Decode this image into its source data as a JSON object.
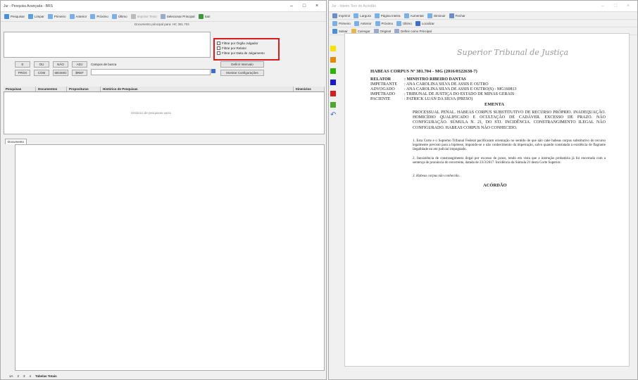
{
  "left_window": {
    "title": "Jur - Pesquisa Avançada - BRS",
    "toolbar": [
      "Pesquisar",
      "Limpar",
      "Primeiro",
      "Anterior",
      "Próximo",
      "Último",
      "Imprimir Texto",
      "Selecionar Principal",
      "Sair"
    ],
    "doc_info": "Documento principal para: HC 381.704",
    "filters": [
      "Filtrar por Órgão Julgador",
      "Filtrar por Relator",
      "Filtrar por Data de Julgamento"
    ],
    "ops": [
      "E",
      "OU",
      "NÃO",
      "ADJ",
      "Campos de busca"
    ],
    "ops2": [
      "PROX",
      "COM",
      "MESMO",
      "$REF"
    ],
    "btn_define": "Definir Intervalo",
    "btn_config": "Mostrar Configurações",
    "tabs": [
      "Pesquisas",
      "Documentos",
      "Proposituras",
      "Histórico de Pesquisas",
      "Itinerários"
    ],
    "empty_msg": "Histórico de pesquisas vazio",
    "doc_tab": "Documento",
    "footer_tabs": [
      "1A",
      "2",
      "3",
      "4",
      "Tabelas Totais"
    ]
  },
  "right_window": {
    "title": "Jur - Inteiro Teor do Acórdão",
    "toolbar1": [
      "Imprimir",
      "Largura",
      "Página Inteira",
      "Aumentar",
      "Diminuir",
      "Fechar"
    ],
    "toolbar2": [
      "Primeiro",
      "Anterior",
      "Próximo",
      "Último",
      "Localizar"
    ],
    "toolbar3": [
      "Salvar",
      "Carregar",
      "Original",
      "Definir como Principal"
    ],
    "swatch_colors": [
      "#f7e300",
      "#e88a00",
      "#2bb500",
      "#1a1ad6",
      "#d81c1c",
      "#4aa82f"
    ]
  },
  "document": {
    "court_signature": "Superior Tribunal de Justiça",
    "process_title": "HABEAS CORPUS Nº 381.704 - MG (2016/0322638-7)",
    "parties": [
      {
        "role": "RELATOR",
        "name": ": MINISTRO RIBEIRO DANTAS"
      },
      {
        "role": "IMPETRANTE",
        "name": ": ANA CAROLINA SILVA DE ASSIS E OUTRO"
      },
      {
        "role": "ADVOGADO",
        "name": ": ANA CAROLINA SILVA DE ASSIS E OUTRO(S) - MG160813"
      },
      {
        "role": "IMPETRADO",
        "name": ": TRIBUNAL DE JUSTIÇA DO ESTADO DE MINAS GERAIS"
      },
      {
        "role": "PACIENTE",
        "name": ": PATRICK LUAN DA SILVA (PRESO)"
      }
    ],
    "ementa_heading": "EMENTA",
    "ementa_text": "Processual penal. Habeas corpus substitutivo de recurso próprio. Inadequação. Homicídio qualificado e ocultação de cadáver. Excesso de prazo. Não configuração. Súmula n. 21, do STJ. Incidência. Constrangimento ilegal não configurado. Habeas corpus não conhecido.",
    "paragraph_1": "1. Esta Corte e o Supremo Tribunal Federal pacificaram orientação no sentido de que não cabe habeas corpus substitutivo do recurso legalmente previsto para a hipótese, impondo-se o não conhecimento da impetração, salvo quando constatada a existência de flagrante ilegalidade no ato judicial impugnado.",
    "paragraph_2": "2. Inexistência de constrangimento ilegal por excesso de prazo, tendo em vista que a instrução probatória já foi encerrada com a sentença de pronúncia do recorrente, datada de 23/3/2017. Incidência da Súmula 21 desta Corte Superior.",
    "paragraph_3": "3. Habeas corpus não conhecido.",
    "acordao_heading": "ACÓRDÃO"
  }
}
